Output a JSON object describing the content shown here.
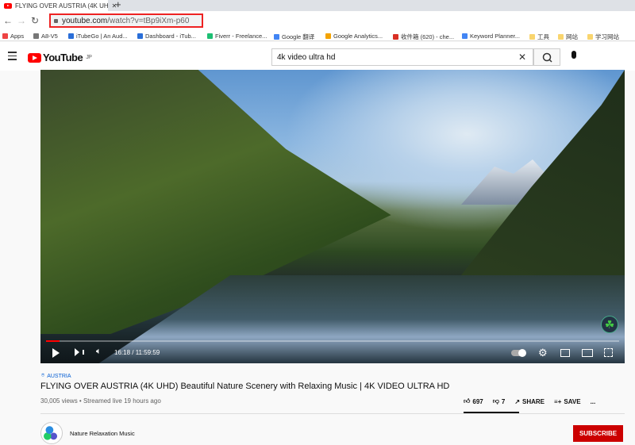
{
  "browser": {
    "tab_title": "FLYING OVER AUSTRIA (4K UH",
    "url_host": "youtube.com",
    "url_path": "/watch?v=tBp9iXm-p60",
    "bookmarks": [
      {
        "label": "Apps",
        "color": "#e44"
      },
      {
        "label": "A8-V5",
        "color": "#777"
      },
      {
        "label": "iTubeGo | An Aud...",
        "color": "#2a6ed8"
      },
      {
        "label": "Dashboard - iTub...",
        "color": "#2a6ed8"
      },
      {
        "label": "Fiverr - Freelance...",
        "color": "#1dbf73"
      },
      {
        "label": "Google 翻译",
        "color": "#4285f4"
      },
      {
        "label": "Google Analytics...",
        "color": "#f4a300"
      },
      {
        "label": "收件箱 (620) - che...",
        "color": "#d93025"
      },
      {
        "label": "Keyword Planner...",
        "color": "#4285f4"
      },
      {
        "label": "工具",
        "color": "#f9d56e"
      },
      {
        "label": "网站",
        "color": "#f9d56e"
      },
      {
        "label": "学习网站",
        "color": "#f9d56e"
      }
    ]
  },
  "youtube": {
    "logo": "YouTube",
    "region": "JP",
    "search_value": "4k video ultra hd"
  },
  "player": {
    "time": "16:18 / 11:59:59",
    "progress_percent": 2.3
  },
  "video": {
    "location": "AUSTRIA",
    "title": "FLYING OVER AUSTRIA (4K UHD) Beautiful Nature Scenery with Relaxing Music | 4K VIDEO ULTRA HD",
    "views": "30,005 views • Streamed live 19 hours ago",
    "likes": "697",
    "dislikes": "7",
    "share": "SHARE",
    "save": "SAVE",
    "more": "..."
  },
  "channel": {
    "name": "Nature Relaxation Music",
    "subscribe": "SUBSCRIBE"
  }
}
